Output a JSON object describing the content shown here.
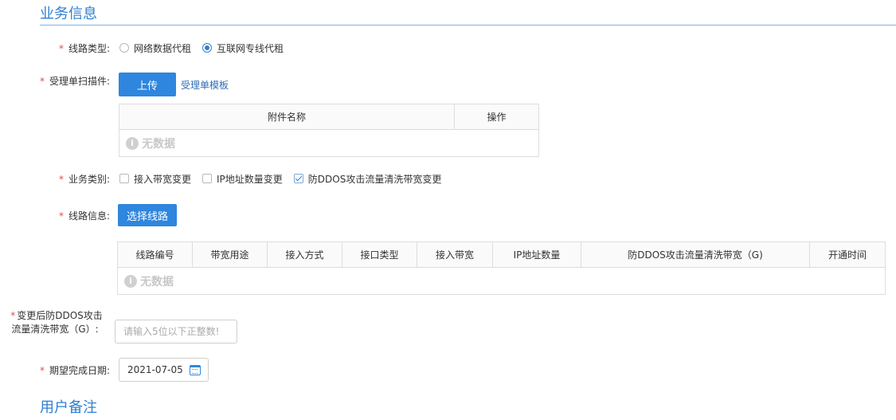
{
  "sections": {
    "business_info": "业务信息",
    "user_remarks": "用户备注"
  },
  "line_type": {
    "label": "线路类型:",
    "options": [
      "网络数据代租",
      "互联网专线代租"
    ],
    "selected": "互联网专线代租"
  },
  "scan_upload": {
    "label": "受理单扫描件:",
    "upload_button": "上传",
    "template_link": "受理单模板",
    "table": {
      "headers": [
        "附件名称",
        "操作"
      ],
      "empty_text": "无数据"
    }
  },
  "business_category": {
    "label": "业务类别:",
    "options": [
      {
        "label": "接入带宽变更",
        "checked": false
      },
      {
        "label": "IP地址数量变更",
        "checked": false
      },
      {
        "label": "防DDOS攻击流量清洗带宽变更",
        "checked": true
      }
    ]
  },
  "line_info": {
    "label": "线路信息:",
    "select_button": "选择线路",
    "table": {
      "headers": [
        "线路编号",
        "带宽用途",
        "接入方式",
        "接口类型",
        "接入带宽",
        "IP地址数量",
        "防DDOS攻击流量清洗带宽（G)",
        "开通时间"
      ],
      "empty_text": "无数据"
    }
  },
  "ddos_bandwidth": {
    "label_line1": "变更后防DDOS攻击",
    "label_line2": "流量清洗带宽（G）:",
    "placeholder": "请输入5位以下正整数!",
    "value": ""
  },
  "expected_date": {
    "label": "期望完成日期:",
    "value": "2021-07-05"
  },
  "colors": {
    "accent": "#2e86de",
    "required": "#e34c4c",
    "section_title": "#2f7fd0"
  }
}
